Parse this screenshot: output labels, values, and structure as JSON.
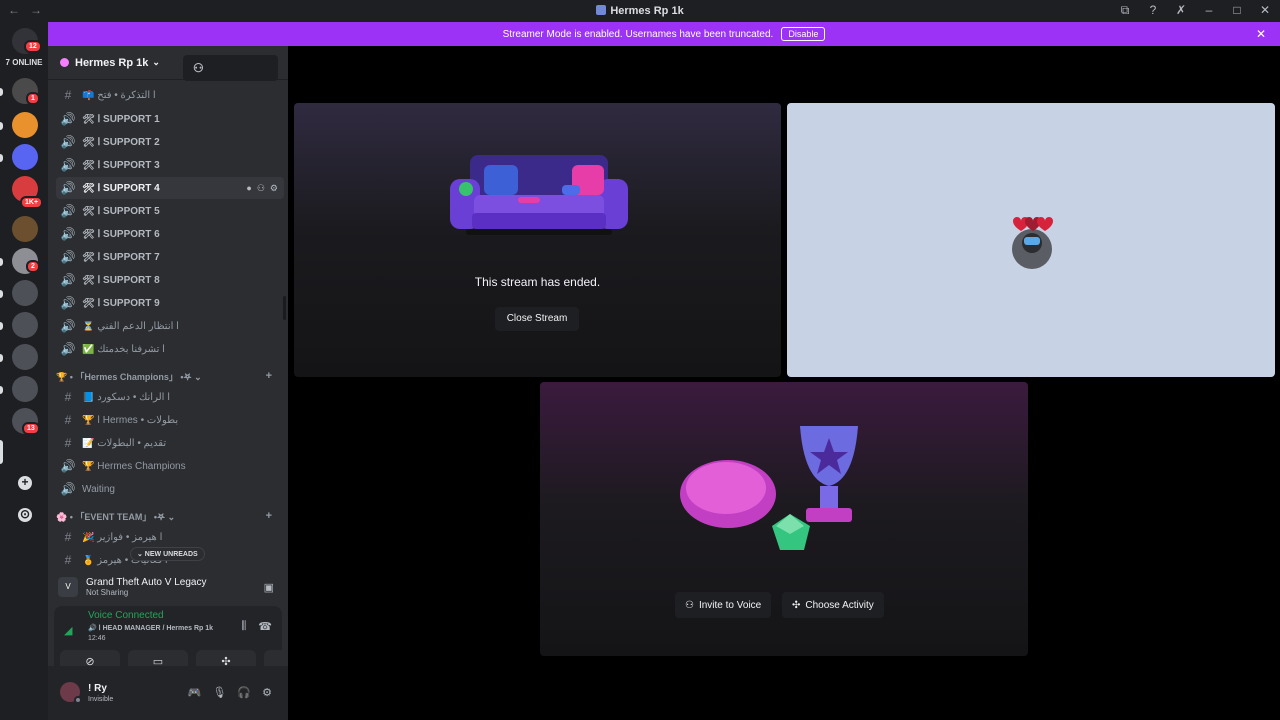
{
  "window": {
    "title": "Hermes Rp 1k",
    "back_icon": "←",
    "forward_icon": "→"
  },
  "banner": {
    "message": "Streamer Mode is enabled. Usernames have been truncated.",
    "disable_label": "Disable",
    "close_icon": "✕"
  },
  "rail": {
    "dm_badge": "12",
    "online_label": "7 ONLINE",
    "badges": [
      "1",
      "1K+",
      "2",
      "13"
    ]
  },
  "guild": {
    "name": "Hermes Rp 1k",
    "chevron": "⌄"
  },
  "channels": [
    {
      "icon": "#",
      "label": "📫 ا التذكرة • فتح",
      "type": "text"
    },
    {
      "icon": "🔊",
      "label": "🛠 ا SUPPORT 1",
      "type": "voice"
    },
    {
      "icon": "🔊",
      "label": "🛠 ا SUPPORT 2",
      "type": "voice"
    },
    {
      "icon": "🔊",
      "label": "🛠 ا SUPPORT 3",
      "type": "voice"
    },
    {
      "icon": "🔊",
      "label": "🛠 ا SUPPORT 4",
      "type": "voice",
      "active": true
    },
    {
      "icon": "🔊",
      "label": "🛠 ا SUPPORT 5",
      "type": "voice"
    },
    {
      "icon": "🔊",
      "label": "🛠 ا SUPPORT 6",
      "type": "voice"
    },
    {
      "icon": "🔊",
      "label": "🛠 ا SUPPORT 7",
      "type": "voice"
    },
    {
      "icon": "🔊",
      "label": "🛠 ا SUPPORT 8",
      "type": "voice"
    },
    {
      "icon": "🔊",
      "label": "🛠 ا SUPPORT 9",
      "type": "voice"
    },
    {
      "icon": "🔊",
      "label": "⏳ ا انتظار الدعم الفني",
      "type": "voice"
    },
    {
      "icon": "🔊",
      "label": "✅ ا تشرفنا بخدمتك",
      "type": "voice"
    }
  ],
  "category1": {
    "label": "🏆 • 「Hermes Champions」 •𖤐 ⌄",
    "plus": "+"
  },
  "channels2": [
    {
      "icon": "#",
      "label": "📘 ا الرانك • دسكورد"
    },
    {
      "icon": "#",
      "label": "🏆 ا Hermes • بطولات"
    },
    {
      "icon": "#",
      "label": "📝 تقديم • البطولات"
    },
    {
      "icon": "🔊",
      "label": "🏆 Hermes Champions"
    },
    {
      "icon": "🔊",
      "label": "Waiting"
    }
  ],
  "category2": {
    "label": "🌸 • 「EVENT TEAM」 •𖤐 ⌄",
    "plus": "+"
  },
  "channels3": [
    {
      "icon": "#",
      "label": "🎉 ا هيرمز • فوازير"
    },
    {
      "icon": "#",
      "label": "🏅 ا فعاليات • هيرمز"
    }
  ],
  "new_unreads": "⌄ NEW UNREADS",
  "activity": {
    "game": "Grand Theft Auto V Legacy",
    "status": "Not Sharing"
  },
  "voice": {
    "status": "Voice Connected",
    "channel": "🔊 ا HEAD MANAGER / Hermes Rp 1k",
    "time": "12:46"
  },
  "user": {
    "name": "! Ry",
    "status": "Invisible"
  },
  "stream": {
    "ended_text": "This stream has ended.",
    "close_label": "Close Stream",
    "invite_label": "Invite to Voice",
    "activity_label": "Choose Activity"
  },
  "colors": {
    "banner": "#9b32f5",
    "sidebar": "#2b2d31",
    "rail": "#1e1f22",
    "voice_green": "#23a559",
    "badge_red": "#f23f43"
  }
}
